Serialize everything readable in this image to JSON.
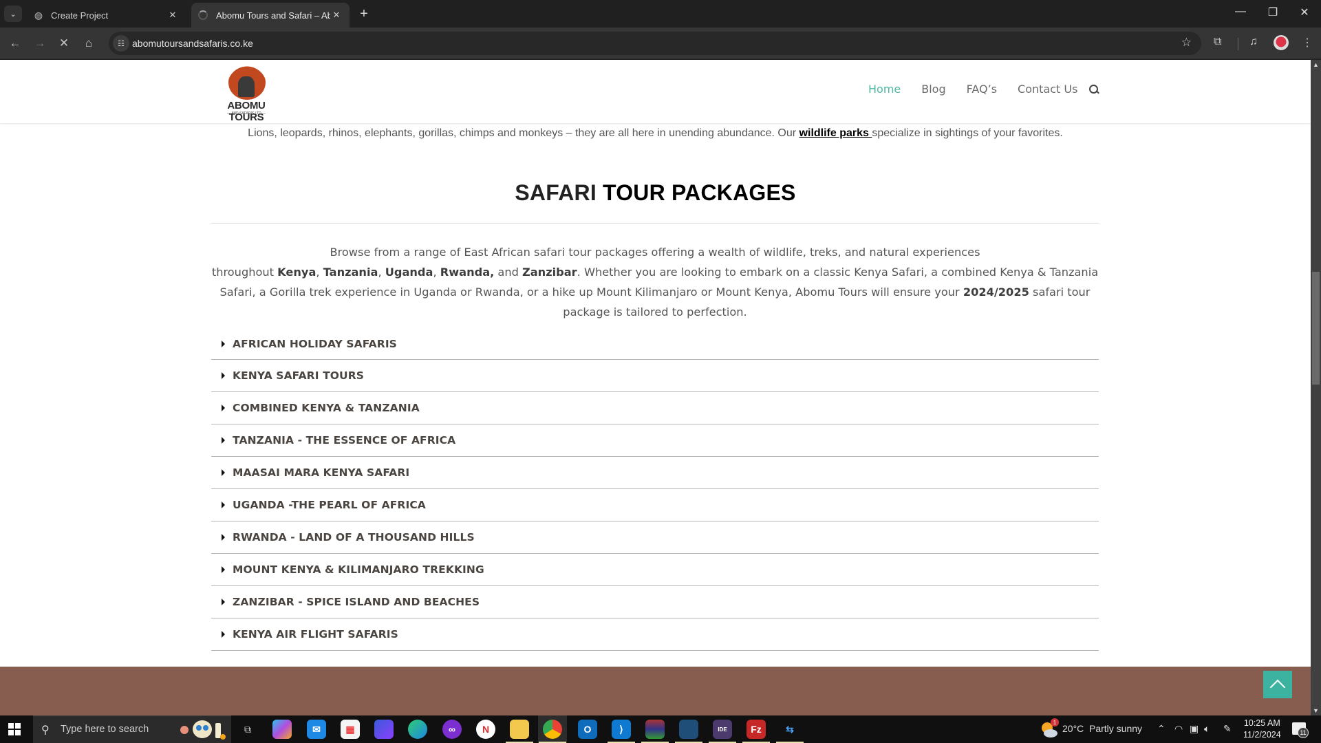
{
  "browser": {
    "tabs": [
      {
        "title": "Create Project",
        "icon": "globe-icon",
        "active": false
      },
      {
        "title": "Abomu Tours and Safari – Abomu",
        "icon": "loading-spinner-icon",
        "active": true
      }
    ],
    "new_tab_label": "+",
    "url": "abomutoursandsafaris.co.ke",
    "window_controls": {
      "minimize": "—",
      "restore": "❐",
      "close": "✕"
    }
  },
  "site": {
    "logo": {
      "name": "ABOMU TOURS",
      "tagline": "— AND SAFARIS LTD —"
    },
    "nav": [
      {
        "label": "Home",
        "current": true
      },
      {
        "label": "Blog",
        "current": false
      },
      {
        "label": "FAQ’s",
        "current": false
      },
      {
        "label": "Contact Us",
        "current": false
      }
    ],
    "intro": {
      "before": "Lions, leopards, rhinos, elephants, gorillas, chimps and monkeys – they are all here in unending abundance. Our ",
      "link": "wildlife parks ",
      "after": "specialize in sightings of your favorites."
    },
    "section_title": {
      "light": "SAFARI ",
      "bold": "TOUR PACKAGES"
    },
    "description": {
      "line1": "Browse from a range of East African safari tour packages offering a wealth of wildlife, treks, and natural experiences",
      "p_throughout": "throughout ",
      "kenya": "Kenya",
      "comma1": ", ",
      "tanzania": "Tanzania",
      "comma2": ", ",
      "uganda": "Uganda",
      "comma3": ", ",
      "rwanda": "Rwanda,",
      "and": " and ",
      "zanzibar": "Zanzibar",
      "rest": ". Whether you are looking to embark on a classic Kenya Safari, a combined Kenya & Tanzania Safari, a Gorilla trek experience in Uganda or Rwanda, or a hike up Mount Kilimanjaro or Mount Kenya, Abomu Tours will ensure your ",
      "years": "2024/2025",
      "end": " safari tour package is tailored to perfection."
    },
    "accordion": [
      "AFRICAN HOLIDAY SAFARIS",
      "KENYA SAFARI TOURS",
      "COMBINED KENYA & TANZANIA",
      "TANZANIA - THE ESSENCE OF AFRICA",
      "MAASAI MARA KENYA SAFARI",
      "UGANDA -THE PEARL OF AFRICA",
      "RWANDA - LAND OF A THOUSAND HILLS",
      "MOUNT KENYA & KILIMANJARO TREKKING",
      "ZANZIBAR - SPICE ISLAND AND BEACHES",
      "KENYA AIR FLIGHT SAFARIS"
    ],
    "colors": {
      "accent": "#4fb8a2",
      "footer": "#865d4e",
      "to_top": "#3cb2a0"
    }
  },
  "taskbar": {
    "search_placeholder": "Type here to search",
    "apps": [
      "task-view",
      "copilot",
      "mail",
      "microsoft-store",
      "clipchamp",
      "edge",
      "app-purple",
      "news",
      "file-explorer",
      "chrome",
      "outlook",
      "vscode",
      "winrar",
      "mysql-workbench",
      "java-ee-ide",
      "filezilla",
      "network-tool"
    ],
    "weather": {
      "temp": "20°C",
      "condition": "Partly sunny",
      "badge": "1"
    },
    "time": "10:25 AM",
    "date": "11/2/2024",
    "notifications": "11"
  }
}
